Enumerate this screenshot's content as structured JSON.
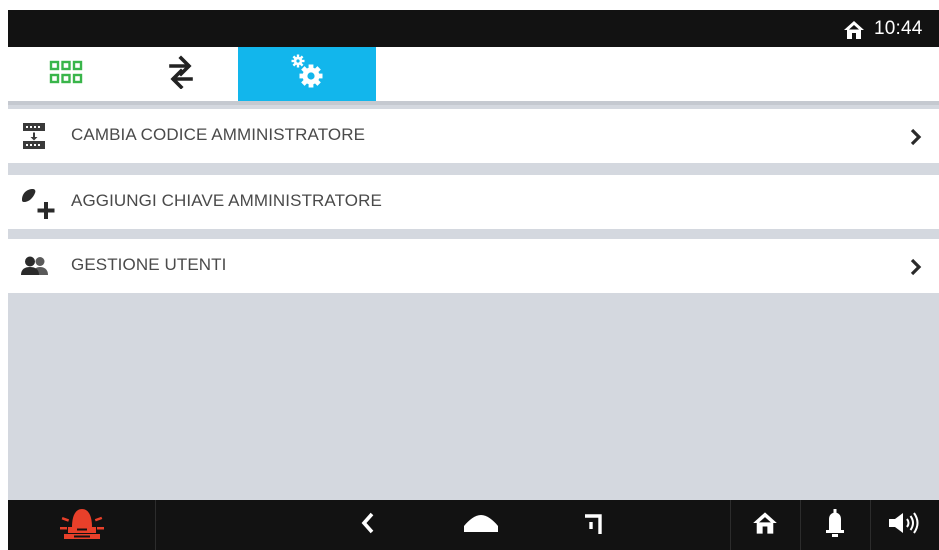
{
  "status_bar": {
    "home_icon": "home-icon",
    "time": "10:44"
  },
  "tabs": [
    {
      "icon": "apps-grid-icon",
      "color": "#39b54a",
      "active": false
    },
    {
      "icon": "swap-arrows-icon",
      "color": "#222222",
      "active": false
    },
    {
      "icon": "settings-gears-icon",
      "color": "#ffffff",
      "active": true
    }
  ],
  "menu": {
    "items": [
      {
        "label": "CAMBIA CODICE AMMINISTRATORE",
        "icon": "change-code-icon",
        "has_chevron": true
      },
      {
        "label": "AGGIUNGI CHIAVE AMMINISTRATORE",
        "icon": "add-key-icon",
        "has_chevron": false
      },
      {
        "label": "GESTIONE UTENTI",
        "icon": "users-icon",
        "has_chevron": true
      }
    ]
  },
  "nav_bar": {
    "items": [
      {
        "icon": "alarm-siren-icon",
        "color": "#e8402a"
      },
      {
        "icon": "back-chevron-icon"
      },
      {
        "icon": "home-dome-icon"
      },
      {
        "icon": "recent-corner-icon"
      },
      {
        "icon": "home-icon"
      },
      {
        "icon": "bell-icon"
      },
      {
        "icon": "volume-icon"
      }
    ]
  },
  "colors": {
    "accent": "#12b6ec",
    "grid_green": "#39b54a",
    "alarm_red": "#e8402a",
    "background": "#d4d8df"
  }
}
